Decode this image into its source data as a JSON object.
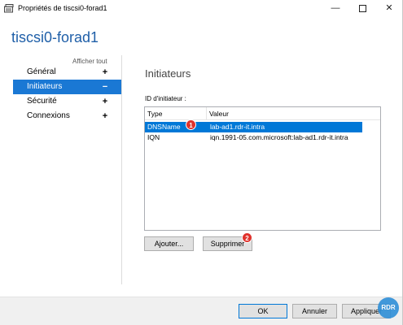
{
  "window": {
    "title": "Propriétés de tiscsi0-forad1",
    "minimize_glyph": "—",
    "close_glyph": "✕"
  },
  "page": {
    "title": "tiscsi0-forad1"
  },
  "sidebar": {
    "show_all_label": "Afficher tout",
    "items": [
      {
        "label": "Général",
        "sign": "+",
        "active": false
      },
      {
        "label": "Initiateurs",
        "sign": "−",
        "active": true
      },
      {
        "label": "Sécurité",
        "sign": "+",
        "active": false
      },
      {
        "label": "Connexions",
        "sign": "+",
        "active": false
      }
    ]
  },
  "main": {
    "section_title": "Initiateurs",
    "id_label": "ID d'initiateur :",
    "table": {
      "columns": [
        "Type",
        "Valeur"
      ],
      "rows": [
        {
          "type": "DNSName",
          "value": "lab-ad1.rdr-it.intra",
          "selected": true
        },
        {
          "type": "IQN",
          "value": "iqn.1991-05.com.microsoft:lab-ad1.rdr-it.intra",
          "selected": false
        }
      ]
    },
    "buttons": {
      "add": "Ajouter...",
      "remove": "Supprimer"
    }
  },
  "annotations": {
    "badge1": "1",
    "badge2": "2"
  },
  "footer": {
    "ok": "OK",
    "cancel": "Annuler",
    "apply": "Appliquer"
  },
  "watermark": "RDR",
  "colors": {
    "accent": "#1a78d4",
    "selection": "#0078d7",
    "title": "#1f5fa8",
    "badge": "#e0322c"
  }
}
